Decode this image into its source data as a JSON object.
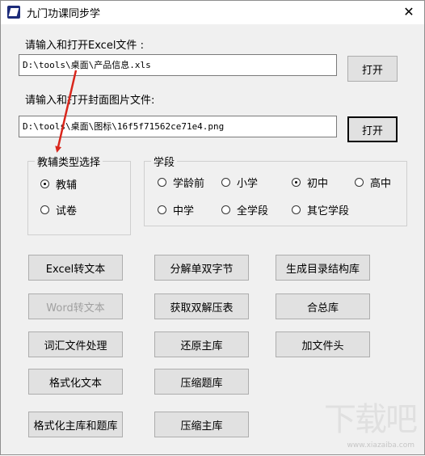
{
  "window": {
    "title": "九门功课同步学",
    "close_glyph": "✕"
  },
  "excel": {
    "label": "请输入和打开Excel文件 :",
    "value": "D:\\tools\\桌面\\产品信息.xls",
    "open_button": "打开"
  },
  "cover": {
    "label": "请输入和打开封面图片文件:",
    "value": "D:\\tools\\桌面\\图标\\16f5f71562ce71e4.png",
    "open_button": "打开"
  },
  "type_group": {
    "title": "教辅类型选择",
    "options": [
      {
        "label": "教辅",
        "checked": true
      },
      {
        "label": "试卷",
        "checked": false
      }
    ]
  },
  "stage_group": {
    "title": "学段",
    "options": [
      {
        "label": "学龄前",
        "checked": false
      },
      {
        "label": "小学",
        "checked": false
      },
      {
        "label": "初中",
        "checked": true
      },
      {
        "label": "高中",
        "checked": false
      },
      {
        "label": "中学",
        "checked": false
      },
      {
        "label": "全学段",
        "checked": false
      },
      {
        "label": "其它学段",
        "checked": false
      }
    ]
  },
  "buttons": {
    "excel_to_text": "Excel转文本",
    "split_word": "分解单双字节",
    "gen_catalog": "生成目录结构库",
    "word_to_text": "Word转文本",
    "get_double_table": "获取双解压表",
    "merge_lib": "合总库",
    "vocab_process": "词汇文件处理",
    "restore_main": "还原主库",
    "add_header": "加文件头",
    "format_text": "格式化文本",
    "compress_questions": "压缩题库",
    "format_main_questions": "格式化主库和题库",
    "compress_main": "压缩主库"
  },
  "watermark": {
    "brand": "下载吧",
    "url": "www.xiazaiba.com"
  },
  "colors": {
    "arrow": "#d9261c"
  }
}
